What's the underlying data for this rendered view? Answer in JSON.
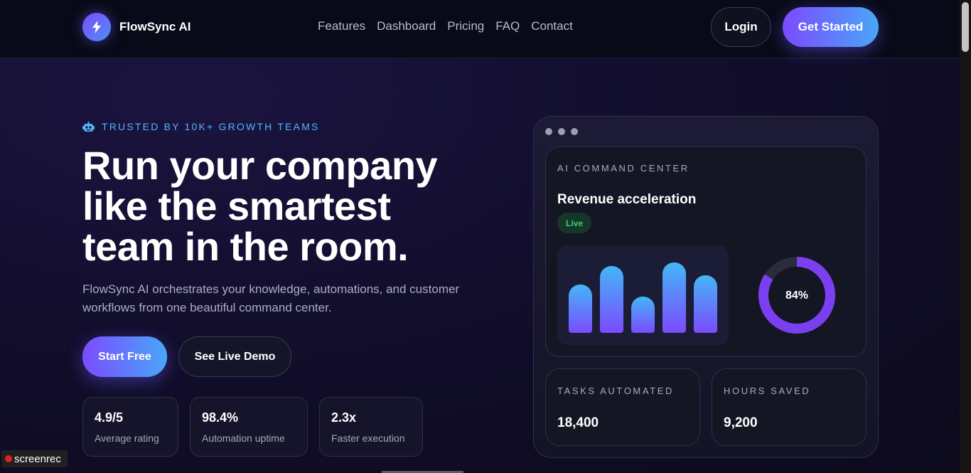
{
  "header": {
    "brand": "FlowSync AI",
    "logo_icon": "lightning-bolt-icon",
    "nav": [
      "Features",
      "Dashboard",
      "Pricing",
      "FAQ",
      "Contact"
    ],
    "login_label": "Login",
    "get_started_label": "Get Started"
  },
  "hero": {
    "eyebrow_icon": "robot-icon",
    "eyebrow": "TRUSTED BY 10K+ GROWTH TEAMS",
    "headline_lines": [
      "Run your company",
      "like the smartest",
      "team in the room."
    ],
    "subtext": "FlowSync AI orchestrates your knowledge, automations, and customer workflows from one beautiful command center.",
    "cta_primary": "Start Free",
    "cta_secondary": "See Live Demo",
    "stats": [
      {
        "value": "4.9/5",
        "label": "Average rating"
      },
      {
        "value": "98.4%",
        "label": "Automation uptime"
      },
      {
        "value": "2.3x",
        "label": "Faster execution"
      }
    ]
  },
  "dashboard": {
    "eyebrow": "AI COMMAND CENTER",
    "title": "Revenue acceleration",
    "badge": "Live",
    "bar_levels": [
      0.62,
      0.85,
      0.46,
      0.9,
      0.74
    ],
    "donut_percent": 84,
    "donut_label": "84%",
    "tiles": [
      {
        "label": "TASKS AUTOMATED",
        "value": "18,400"
      },
      {
        "label": "HOURS SAVED",
        "value": "9,200"
      }
    ]
  },
  "colors": {
    "accent_purple": "#7b4bff",
    "accent_blue": "#4aa6f8",
    "live_green": "#36d26a",
    "eyebrow_blue": "#4db7ff"
  },
  "watermark": "screenrec"
}
